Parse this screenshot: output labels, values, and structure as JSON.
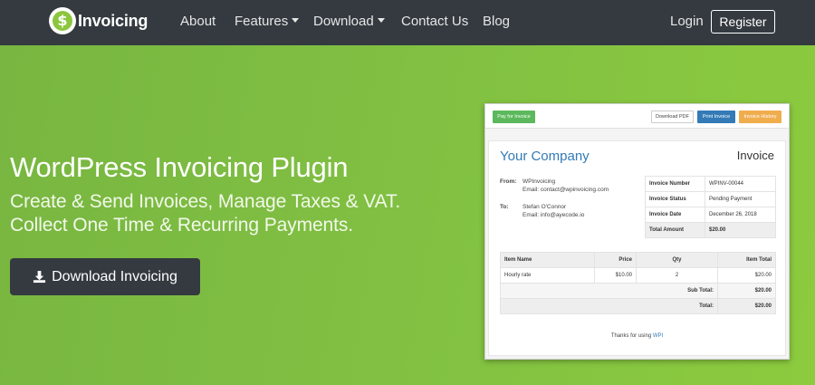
{
  "nav": {
    "brand": "Invoicing",
    "logo_glyph": "$",
    "items": [
      {
        "label": "About"
      },
      {
        "label": "Features",
        "dropdown": true
      },
      {
        "label": "Download",
        "dropdown": true
      },
      {
        "label": "Contact Us"
      },
      {
        "label": "Blog"
      }
    ],
    "login": "Login",
    "register": "Register"
  },
  "hero": {
    "title": "WordPress Invoicing Plugin",
    "subtitle_line1": "Create & Send Invoices, Manage Taxes & VAT.",
    "subtitle_line2": "Collect One Time & Recurring Payments.",
    "cta": "Download Invoicing",
    "cta_icon": "download-icon"
  },
  "invoice_preview": {
    "toolbar": {
      "pay": "Pay for Invoice",
      "pdf": "Download PDF",
      "print": "Print Invoice",
      "history": "Invoice History"
    },
    "company": "Your Company",
    "heading": "Invoice",
    "from": {
      "label": "From:",
      "name": "WPInvoicing",
      "email": "Email: contact@wpinvoicing.com"
    },
    "to": {
      "label": "To:",
      "name": "Stefan O'Connor",
      "email": "Email: info@ayecode.io"
    },
    "meta": [
      {
        "key": "Invoice Number",
        "value": "WPINV-00044"
      },
      {
        "key": "Invoice Status",
        "value": "Pending Payment"
      },
      {
        "key": "Invoice Date",
        "value": "December 26, 2018"
      },
      {
        "key": "Total Amount",
        "value": "$20.00"
      }
    ],
    "items_table": {
      "headers": [
        "Item Name",
        "Price",
        "Qty",
        "Item Total"
      ],
      "rows": [
        {
          "name": "Hourly rate",
          "price": "$10.00",
          "qty": "2",
          "total": "$20.00"
        }
      ],
      "subtotal_label": "Sub Total:",
      "subtotal_value": "$20.00",
      "total_label": "Total:",
      "total_value": "$20.00"
    },
    "thanks_prefix": "Thanks for using",
    "thanks_link": "WPI"
  },
  "colors": {
    "navbar": "#343a40",
    "hero_green": "#82c142",
    "button_dark": "#343a40",
    "link_blue": "#337ab7",
    "pay_green": "#5cb85c",
    "history_orange": "#f0ad4e"
  }
}
